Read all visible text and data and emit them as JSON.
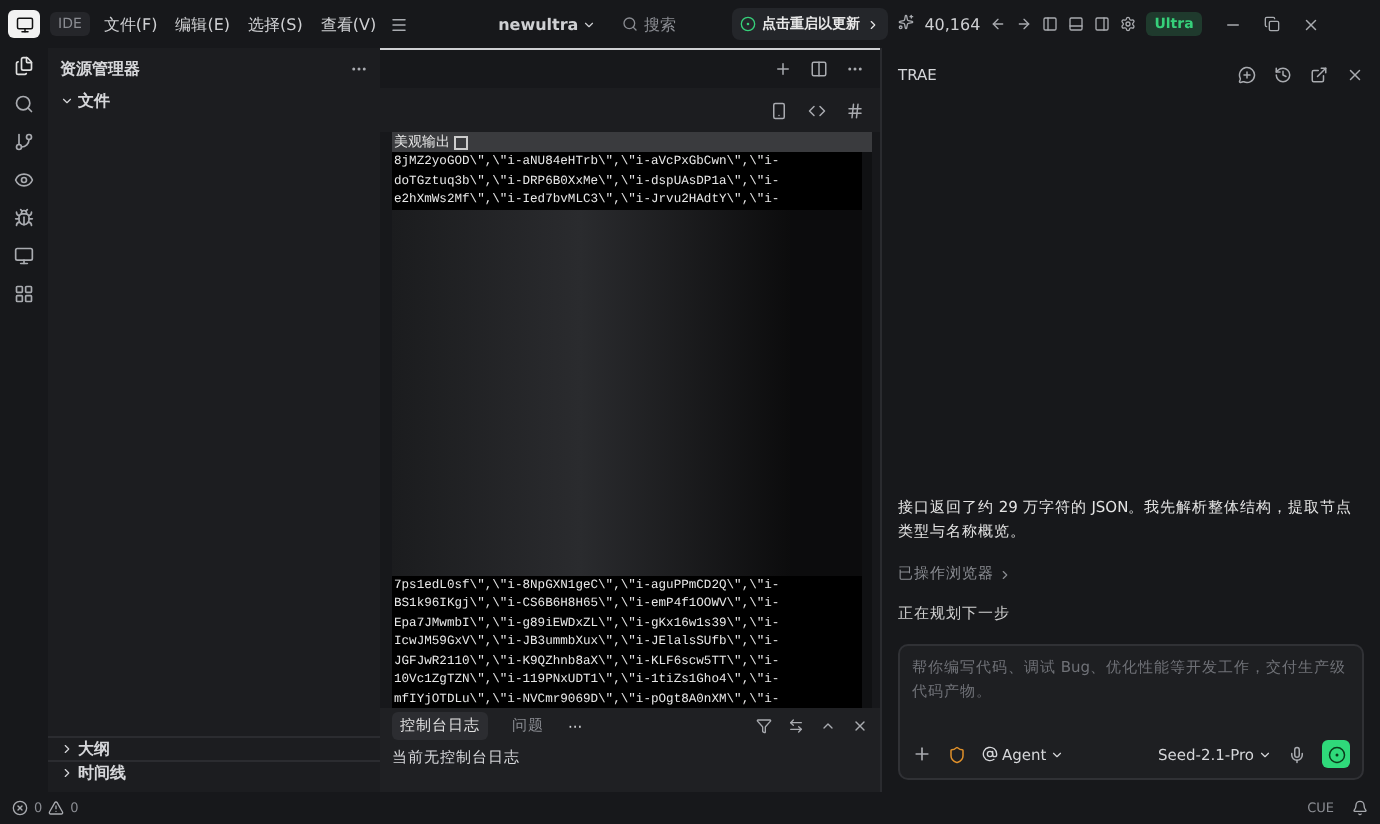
{
  "titlebar": {
    "app_badge": "IDE",
    "menus": [
      "文件(F)",
      "编辑(E)",
      "选择(S)",
      "查看(V)"
    ],
    "project": "newultra",
    "search_placeholder": "搜索",
    "update_button": "点击重启以更新",
    "stars": "40,164",
    "plan": "Ultra"
  },
  "sidebar": {
    "title": "资源管理器",
    "section": {
      "label": "文件",
      "expanded": true
    },
    "bottom_sections": [
      {
        "label": "大纲",
        "expanded": false
      },
      {
        "label": "时间线",
        "expanded": false
      }
    ]
  },
  "preview": {
    "checkbox_label": "美观输出",
    "checked": false,
    "lines_top": [
      "8jMZ2yoGOD\\\",\\\"i-aNU84eHTrb\\\",\\\"i-aVcPxGbCwn\\\",\\\"i-",
      "doTGztuq3b\\\",\\\"i-DRP6B0XxMe\\\",\\\"i-dspUAsDP1a\\\",\\\"i-",
      "e2hXmWs2Mf\\\",\\\"i-Ied7bvMLC3\\\",\\\"i-Jrvu2HAdtY\\\",\\\"i-"
    ],
    "lines_bottom": [
      "7ps1edL0sf\\\",\\\"i-8NpGXN1geC\\\",\\\"i-aguPPmCD2Q\\\",\\\"i-",
      "BS1k96IKgj\\\",\\\"i-CS6B6H8H65\\\",\\\"i-emP4f1OOWV\\\",\\\"i-",
      "Epa7JMwmbI\\\",\\\"i-g89iEWDxZL\\\",\\\"i-gKx16w1s39\\\",\\\"i-",
      "IcwJM59GxV\\\",\\\"i-JB3ummbXux\\\",\\\"i-JElalsSUfb\\\",\\\"i-",
      "JGFJwR2110\\\",\\\"i-K9QZhnb8aX\\\",\\\"i-KLF6scw5TT\\\",\\\"i-",
      "10Vc1ZgTZN\\\",\\\"i-119PNxUDT1\\\",\\\"i-1tiZs1Gho4\\\",\\\"i-",
      "mfIYjOTDLu\\\",\\\"i-NVCmr9069D\\\",\\\"i-pOgt8A0nXM\\\",\\\"i-"
    ]
  },
  "console": {
    "tabs": [
      {
        "label": "控制台日志",
        "selected": true
      },
      {
        "label": "问题",
        "selected": false
      }
    ],
    "more": "···",
    "empty_message": "当前无控制台日志"
  },
  "chat": {
    "title": "TRAE",
    "message": "接口返回了约 29 万字符的 JSON。我先解析整体结构，提取节点类型与名称概览。",
    "activity": "已操作浏览器",
    "status": "正在规划下一步",
    "input_placeholder": "帮你编写代码、调试 Bug、优化性能等开发工作，交付生产级代码产物。",
    "mode": "Agent",
    "model": "Seed-2.1-Pro"
  },
  "status_bar": {
    "errors": "0",
    "warnings": "0",
    "right_label": "CUE"
  }
}
